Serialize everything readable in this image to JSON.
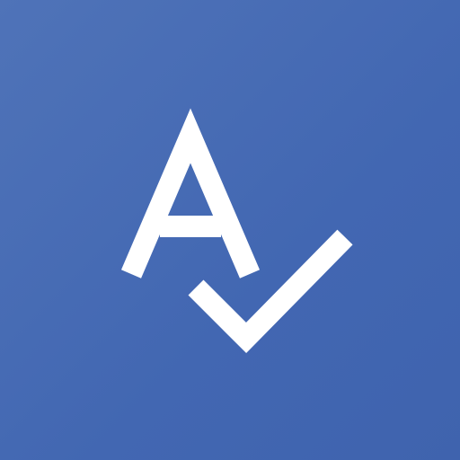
{
  "icon": {
    "letter": "A",
    "symbol": "checkmark-icon",
    "background_color": "#4267b2",
    "foreground_color": "#ffffff"
  }
}
